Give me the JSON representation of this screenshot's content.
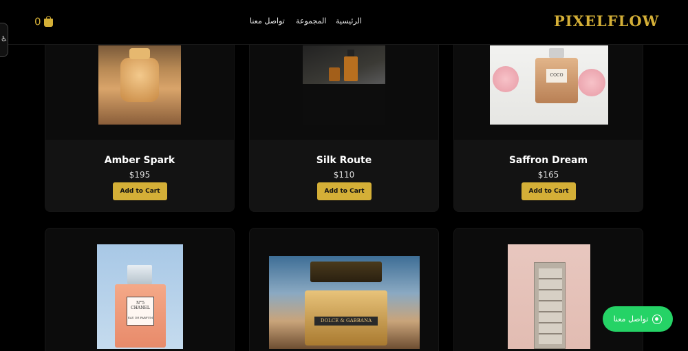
{
  "header": {
    "brand": "PIXELFLOW",
    "nav": [
      {
        "label": "الرئيسية"
      },
      {
        "label": "المجموعة"
      },
      {
        "label": "تواصل معنا"
      }
    ],
    "cart_count": "0"
  },
  "products": [
    {
      "name": "Amber Spark",
      "price": "$195",
      "button": "Add to Cart"
    },
    {
      "name": "Silk Route",
      "price": "$110",
      "button": "Add to Cart"
    },
    {
      "name": "Saffron Dream",
      "price": "$165",
      "button": "Add to Cart"
    },
    {
      "name": "",
      "price": "",
      "button": ""
    },
    {
      "name": "",
      "price": "",
      "button": ""
    },
    {
      "name": "",
      "price": "",
      "button": ""
    }
  ],
  "bottle_labels": {
    "coco": "COCO",
    "chanel_no": "N°5",
    "chanel": "CHANEL",
    "chanel_sub": "EAU DE PARFUM",
    "dg": "DOLCE & GABBANA"
  },
  "whatsapp": {
    "label": "تواصل معنا"
  },
  "colors": {
    "accent": "#d4af37",
    "whatsapp": "#25d366",
    "background": "#000000"
  }
}
